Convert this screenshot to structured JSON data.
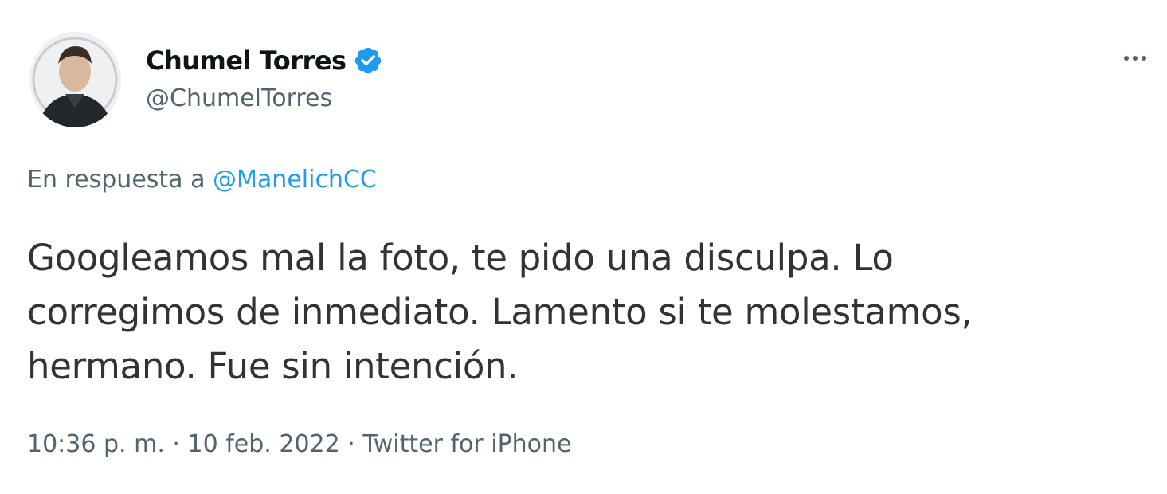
{
  "author": {
    "display_name": "Chumel Torres",
    "handle": "@ChumelTorres",
    "verified": true,
    "verified_color": "#1d9bf0"
  },
  "menu": {
    "icon": "more-horizontal-icon"
  },
  "reply": {
    "prefix": "En respuesta a",
    "mention": "@ManelichCC",
    "mention_color": "#1d9bf0"
  },
  "tweet": {
    "lines": [
      "Googleamos mal la foto, te pido una disculpa. Lo",
      "corregimos de inmediato. Lamento si te molestamos,",
      "hermano. Fue sin intención."
    ]
  },
  "meta": {
    "time": "10:36 p. m.",
    "separator": "·",
    "date": "10 feb. 2022",
    "source": "Twitter for iPhone"
  }
}
